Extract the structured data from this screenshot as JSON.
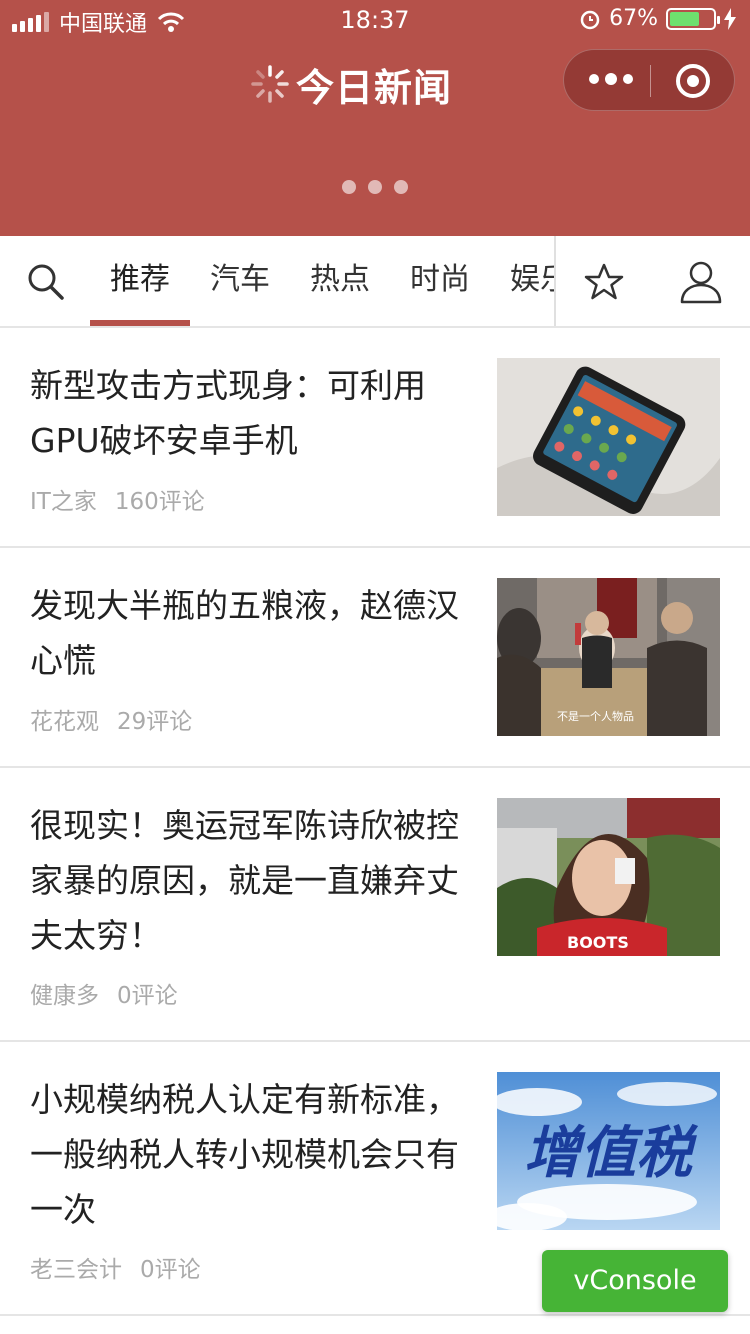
{
  "status_bar": {
    "carrier": "中国联通",
    "time": "18:37",
    "battery": "67%",
    "battery_level": 0.67
  },
  "header": {
    "title": "今日新闻",
    "menu_icon": "more-dots-icon",
    "close_icon": "target-icon",
    "pager_count": 3,
    "brand_color": "#b5514a"
  },
  "nav": {
    "search_icon": "search-icon",
    "tabs": [
      {
        "label": "推荐",
        "active": true
      },
      {
        "label": "汽车",
        "active": false
      },
      {
        "label": "热点",
        "active": false
      },
      {
        "label": "时尚",
        "active": false
      },
      {
        "label": "娱乐",
        "active": false
      }
    ],
    "star_icon": "star-icon",
    "user_icon": "user-icon"
  },
  "articles": [
    {
      "title": "新型攻击方式现身：可利用GPU破坏安卓手机",
      "source": "IT之家",
      "comments": "160评论",
      "image": "phone-photo"
    },
    {
      "title": "发现大半瓶的五粮液，赵德汉心慌",
      "source": "花花观",
      "comments": "29评论",
      "image": "tv-scene-photo",
      "image_caption": "不是一个人物品"
    },
    {
      "title": "很现实！奥运冠军陈诗欣被控家暴的原因，就是一直嫌弃丈夫太穷！",
      "source": "健康多",
      "comments": "0评论",
      "image": "woman-photo"
    },
    {
      "title": "小规模纳税人认定有新标准，一般纳税人转小规模机会只有一次",
      "source": "老三会计",
      "comments": "0评论",
      "image": "tax-photo",
      "image_caption": "增值税"
    }
  ],
  "vconsole": {
    "label": "vConsole"
  }
}
